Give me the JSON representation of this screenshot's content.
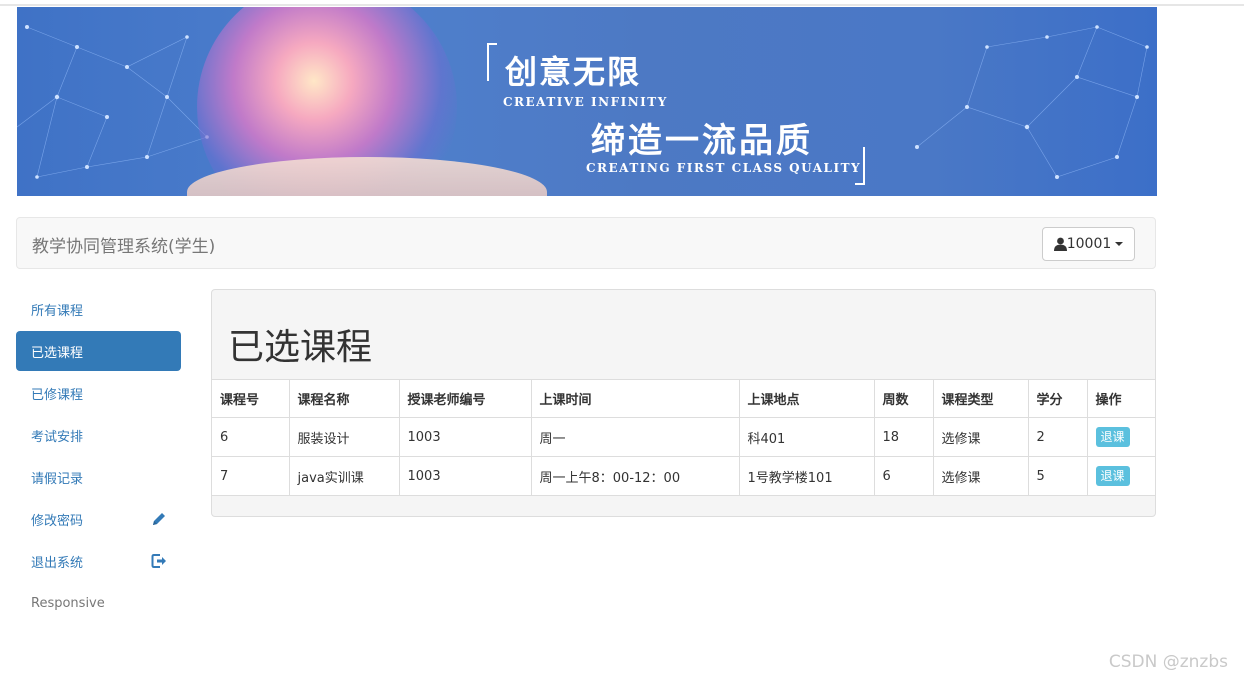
{
  "banner": {
    "slogan_cn_1": "创意无限",
    "slogan_en_1": "CREATIVE INFINITY",
    "slogan_cn_2": "缔造一流品质",
    "slogan_en_2": "CREATING FIRST CLASS QUALITY"
  },
  "navbar": {
    "brand": "教学协同管理系统(学生)",
    "user_label": "10001"
  },
  "sidebar": {
    "items": [
      {
        "label": "所有课程"
      },
      {
        "label": "已选课程"
      },
      {
        "label": "已修课程"
      },
      {
        "label": "考试安排"
      },
      {
        "label": "请假记录"
      },
      {
        "label": "修改密码",
        "icon": "pencil-icon"
      },
      {
        "label": "退出系统",
        "icon": "logout-icon"
      },
      {
        "label": "Responsive"
      }
    ],
    "active_index": 1
  },
  "panel": {
    "title": "已选课程",
    "columns": [
      "课程号",
      "课程名称",
      "授课老师编号",
      "上课时间",
      "上课地点",
      "周数",
      "课程类型",
      "学分",
      "操作"
    ],
    "rows": [
      [
        "6",
        "服装设计",
        "1003",
        "周一",
        "科401",
        "18",
        "选修课",
        "2",
        "退课"
      ],
      [
        "7",
        "java实训课",
        "1003",
        "周一上午8：00-12：00",
        "1号教学楼101",
        "6",
        "选修课",
        "5",
        "退课"
      ]
    ]
  },
  "watermark": "CSDN @znzbs",
  "colors": {
    "primary": "#337ab7",
    "info_button": "#5bc0de",
    "navbar_bg": "#f8f8f8"
  }
}
